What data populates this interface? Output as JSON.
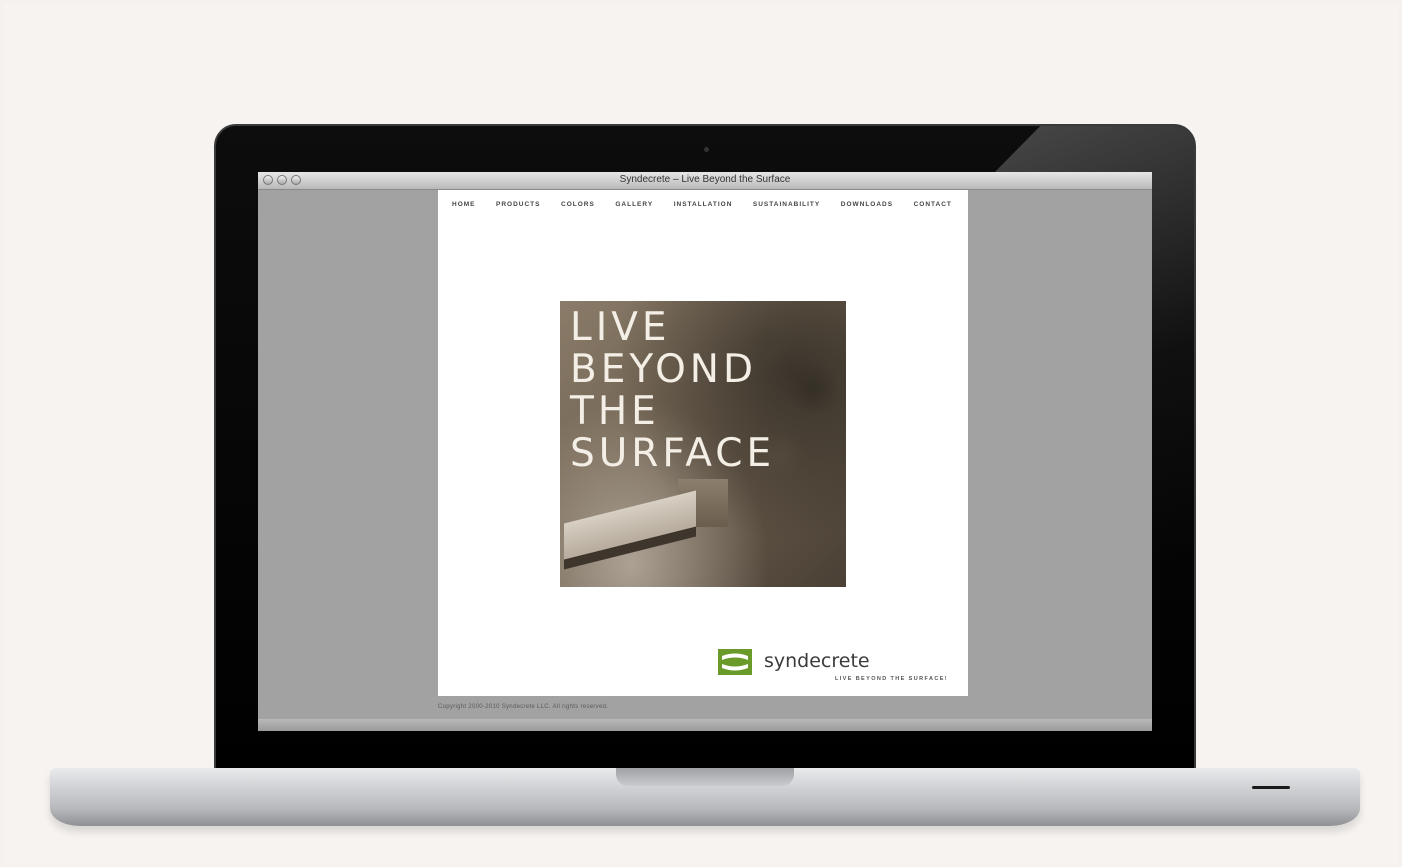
{
  "window": {
    "title": "Syndecrete – Live Beyond the Surface"
  },
  "nav": {
    "items": [
      "HOME",
      "PRODUCTS",
      "COLORS",
      "GALLERY",
      "INSTALLATION",
      "SUSTAINABILITY",
      "DOWNLOADS",
      "CONTACT"
    ]
  },
  "hero": {
    "lines": [
      "LIVE",
      "BEYOND",
      "THE",
      "SURFACE"
    ]
  },
  "brand": {
    "name": "syndecrete",
    "tagline": "LIVE BEYOND THE SURFACE!"
  },
  "footer": {
    "copyright": "Copyright 2000-2010 Syndecrete LLC. All rights reserved."
  },
  "colors": {
    "logo_green": "#6a9a2a",
    "hero_text": "#f4efe6"
  },
  "icons": {
    "window_controls": [
      "close-icon",
      "minimize-icon",
      "zoom-icon"
    ],
    "logo": "syndecrete-logo-icon"
  }
}
